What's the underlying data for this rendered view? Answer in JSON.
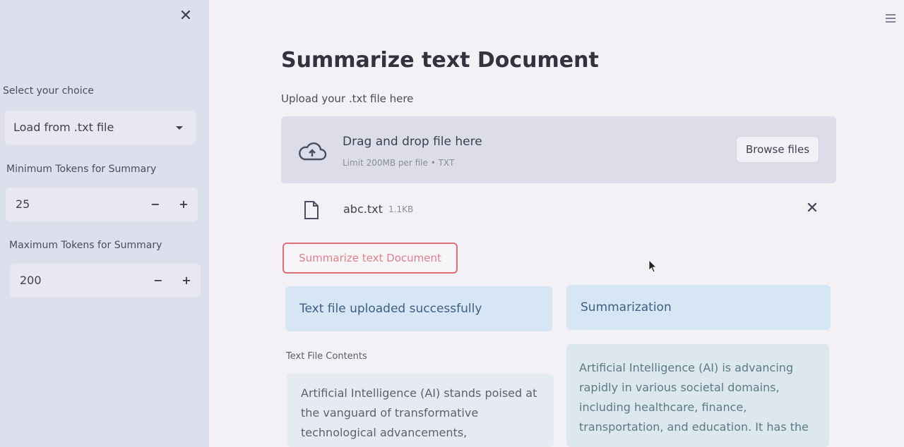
{
  "sidebar": {
    "choice_label": "Select your choice",
    "choice_value": "Load from .txt file",
    "min_tokens_label": "Minimum Tokens for Summary",
    "min_tokens_value": "25",
    "max_tokens_label": "Maximum Tokens for Summary",
    "max_tokens_value": "200",
    "decrement_symbol": "−",
    "increment_symbol": "+",
    "close_symbol": "✕"
  },
  "main": {
    "title": "Summarize text Document",
    "upload_label": "Upload your .txt file here",
    "dropzone": {
      "title": "Drag and drop file here",
      "limit": "Limit 200MB per file • TXT",
      "browse_label": "Browse files"
    },
    "file": {
      "name": "abc.txt",
      "size": "1.1KB",
      "remove_symbol": "✕"
    },
    "summarize_button": "Summarize text Document",
    "success_message": "Text file uploaded successfully",
    "summarization_header": "Summarization",
    "contents_label": "Text File Contents",
    "file_contents": "Artificial Intelligence (AI) stands poised at\nthe vanguard of transformative\ntechnological advancements,",
    "summary_text": "Artificial Intelligence (AI) is advancing\nrapidly in various societal domains,\nincluding healthcare, finance,\ntransportation, and education. It has the"
  },
  "colors": {
    "accent": "#e26d7a",
    "info_bg": "#d6e6f5",
    "sidebar_bg": "#dcdfec"
  },
  "icons": [
    "close-icon",
    "caret-down-icon",
    "cloud-upload-icon",
    "file-icon",
    "menu-icon",
    "mouse-cursor-icon"
  ]
}
